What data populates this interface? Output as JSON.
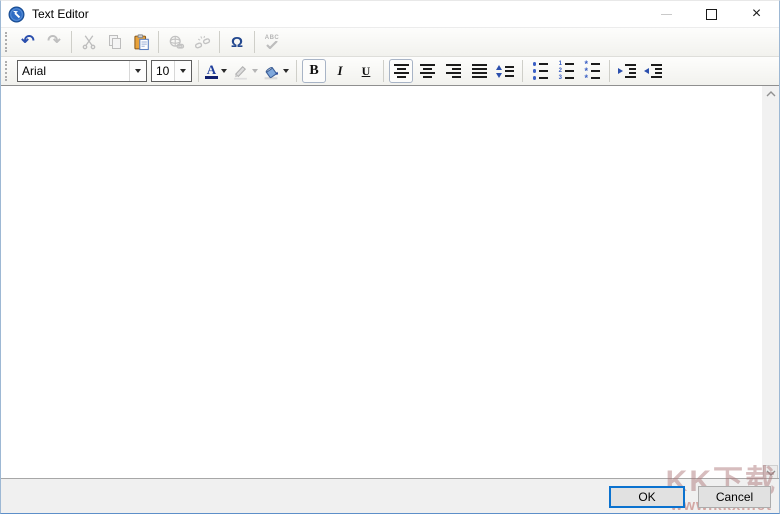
{
  "window": {
    "title": "Text Editor",
    "close_glyph": "×"
  },
  "toolbars": {
    "row1": [
      {
        "type": "grip"
      },
      {
        "type": "button",
        "name": "undo-button",
        "icon": "undo-icon",
        "glyph": "↶",
        "enabled": true
      },
      {
        "type": "button",
        "name": "redo-button",
        "icon": "redo-icon",
        "glyph": "↷",
        "enabled": false
      },
      {
        "type": "sep"
      },
      {
        "type": "button",
        "name": "cut-button",
        "icon": "cut-icon",
        "enabled": false
      },
      {
        "type": "button",
        "name": "copy-button",
        "icon": "copy-icon",
        "enabled": false
      },
      {
        "type": "button",
        "name": "paste-button",
        "icon": "paste-icon",
        "enabled": true
      },
      {
        "type": "sep"
      },
      {
        "type": "button",
        "name": "insert-link-button",
        "icon": "link-icon",
        "enabled": false
      },
      {
        "type": "button",
        "name": "remove-link-button",
        "icon": "unlink-icon",
        "enabled": false
      },
      {
        "type": "sep"
      },
      {
        "type": "button",
        "name": "special-character-button",
        "icon": "omega-icon",
        "glyph": "Ω",
        "enabled": true
      },
      {
        "type": "sep"
      },
      {
        "type": "button",
        "name": "spellcheck-button",
        "icon": "spellcheck-icon",
        "glyph": "ABC",
        "enabled": false
      }
    ],
    "row2": [
      {
        "type": "grip"
      },
      {
        "type": "combo",
        "name": "font-family-select",
        "value": "Arial"
      },
      {
        "type": "combo",
        "name": "font-size-select",
        "value": "10"
      },
      {
        "type": "sep"
      },
      {
        "type": "split",
        "name": "font-color-button",
        "icon": "font-color-icon",
        "glyph": "A",
        "enabled": true
      },
      {
        "type": "split",
        "name": "highlight-color-button",
        "icon": "highlight-icon",
        "enabled": false
      },
      {
        "type": "split",
        "name": "fill-color-button",
        "icon": "fill-color-icon",
        "enabled": true
      },
      {
        "type": "sep"
      },
      {
        "type": "button",
        "name": "bold-button",
        "icon": "bold-icon",
        "glyph": "B",
        "enabled": true,
        "framed": true
      },
      {
        "type": "button",
        "name": "italic-button",
        "icon": "italic-icon",
        "glyph": "I",
        "enabled": true
      },
      {
        "type": "button",
        "name": "underline-button",
        "icon": "underline-icon",
        "glyph": "U",
        "enabled": true
      },
      {
        "type": "sep"
      },
      {
        "type": "button",
        "name": "align-left-button",
        "icon": "align-left-icon",
        "enabled": true,
        "framed": true
      },
      {
        "type": "button",
        "name": "align-center-button",
        "icon": "align-center-icon",
        "enabled": true
      },
      {
        "type": "button",
        "name": "align-right-button",
        "icon": "align-right-icon",
        "enabled": true
      },
      {
        "type": "button",
        "name": "justify-button",
        "icon": "align-justify-icon",
        "enabled": true
      },
      {
        "type": "button",
        "name": "line-spacing-button",
        "icon": "line-spacing-icon",
        "enabled": true
      },
      {
        "type": "sep"
      },
      {
        "type": "button",
        "name": "bullet-list-button",
        "icon": "bullet-list-icon",
        "enabled": true
      },
      {
        "type": "button",
        "name": "numbered-list-button",
        "icon": "numbered-list-icon",
        "glyph": "123",
        "enabled": true
      },
      {
        "type": "button",
        "name": "star-list-button",
        "icon": "star-list-icon",
        "glyph": "*",
        "enabled": true
      },
      {
        "type": "sep"
      },
      {
        "type": "button",
        "name": "increase-indent-button",
        "icon": "increase-indent-icon",
        "enabled": true
      },
      {
        "type": "button",
        "name": "decrease-indent-button",
        "icon": "decrease-indent-icon",
        "enabled": true
      }
    ]
  },
  "editor": {
    "content": ""
  },
  "footer": {
    "ok": "OK",
    "cancel": "Cancel"
  },
  "watermark": {
    "logo": "KK下载",
    "url": "www.kkx.net"
  },
  "colors": {
    "accent_blue": "#2b4fad",
    "disabled_gray": "#bfbfbf",
    "default_button_border": "#0b72cf",
    "footer_bg": "#f0f0f0",
    "watermark_red": "#bc6c66"
  }
}
